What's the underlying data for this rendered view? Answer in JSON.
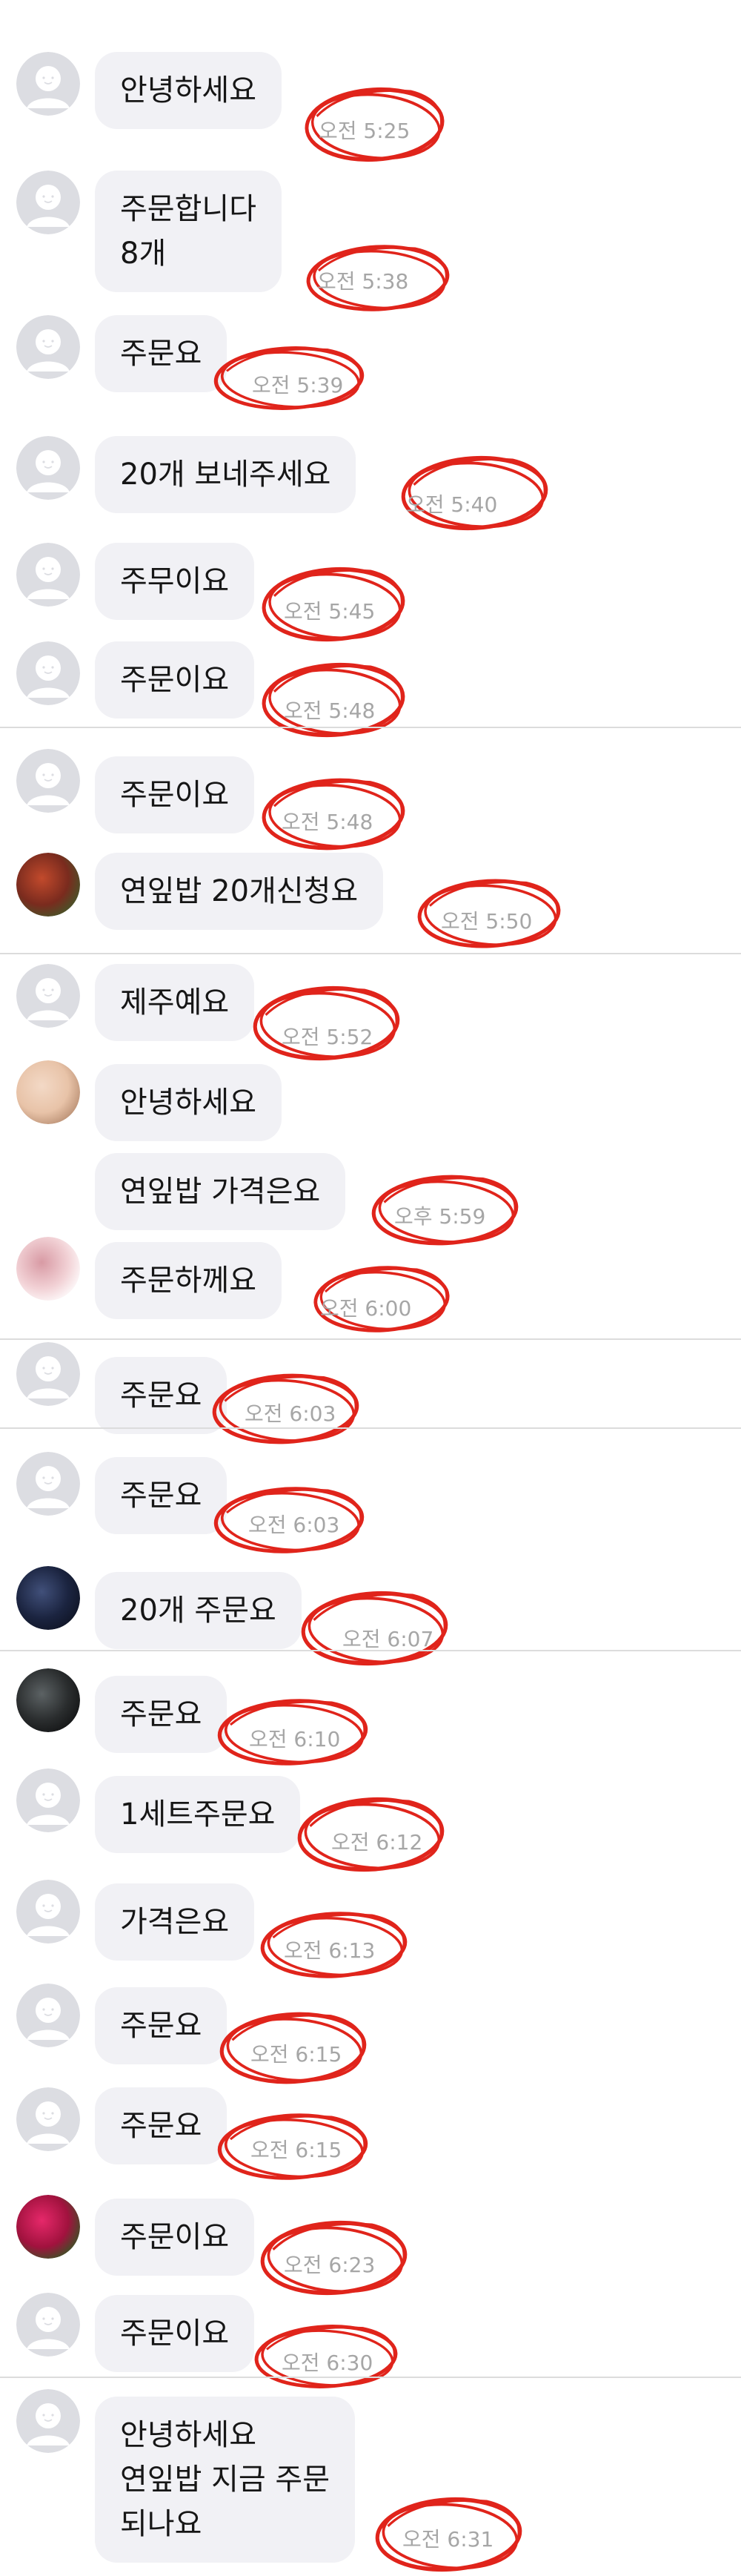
{
  "colors": {
    "bubble": "#f1f1f5",
    "text": "#161616",
    "timestamp": "#a6a6a6",
    "annotation_circle": "#e0241b",
    "default_avatar": "#dcdde2"
  },
  "messages": [
    {
      "lines": [
        "안녕하세요"
      ],
      "time": "오전 5:25",
      "avatar": "default-avatar-icon"
    },
    {
      "lines": [
        "주문합니다",
        "8개"
      ],
      "time": "오전 5:38",
      "avatar": "default-avatar-icon"
    },
    {
      "lines": [
        "주문요"
      ],
      "time": "오전 5:39",
      "avatar": "default-avatar-icon"
    },
    {
      "lines": [
        "20개 보네주세요"
      ],
      "time": "오전 5:40",
      "avatar": "default-avatar-icon"
    },
    {
      "lines": [
        "주무이요"
      ],
      "time": "오전 5:45",
      "avatar": "default-avatar-icon"
    },
    {
      "lines": [
        "주문이요"
      ],
      "time": "오전 5:48",
      "avatar": "default-avatar-icon"
    },
    {
      "lines": [
        "주문이요"
      ],
      "time": "오전 5:48",
      "avatar": "default-avatar-icon"
    },
    {
      "lines": [
        "연잎밥 20개신청요"
      ],
      "time": "오전 5:50",
      "avatar": "flower-photo-avatar"
    },
    {
      "lines": [
        "제주예요"
      ],
      "time": "오전 5:52",
      "avatar": "default-avatar-icon"
    },
    {
      "lines": [
        "안녕하세요"
      ],
      "time": "",
      "avatar": "baby-photo-avatar"
    },
    {
      "lines": [
        "연잎밥 가격은요"
      ],
      "time": "오후 5:59",
      "avatar": ""
    },
    {
      "lines": [
        "주문하께요"
      ],
      "time": "오전 6:00",
      "avatar": "character-photo-avatar"
    },
    {
      "lines": [
        "주문요"
      ],
      "time": "오전 6:03",
      "avatar": "default-avatar-icon"
    },
    {
      "lines": [
        "주문요"
      ],
      "time": "오전 6:03",
      "avatar": "default-avatar-icon"
    },
    {
      "lines": [
        "20개 주문요"
      ],
      "time": "오전 6:07",
      "avatar": "night-street-photo-avatar"
    },
    {
      "lines": [
        "주문요"
      ],
      "time": "오전 6:10",
      "avatar": "dark-photo-avatar"
    },
    {
      "lines": [
        "1세트주문요"
      ],
      "time": "오전 6:12",
      "avatar": "default-avatar-icon"
    },
    {
      "lines": [
        "가격은요"
      ],
      "time": "오전 6:13",
      "avatar": "default-avatar-icon"
    },
    {
      "lines": [
        "주문요"
      ],
      "time": "오전 6:15",
      "avatar": "default-avatar-icon"
    },
    {
      "lines": [
        "주문요"
      ],
      "time": "오전 6:15",
      "avatar": "default-avatar-icon"
    },
    {
      "lines": [
        "주문이요"
      ],
      "time": "오전 6:23",
      "avatar": "rose-photo-avatar"
    },
    {
      "lines": [
        "주문이요"
      ],
      "time": "오전 6:30",
      "avatar": "default-avatar-icon"
    },
    {
      "lines": [
        "안녕하세요",
        "연잎밥 지금 주문",
        "되나요"
      ],
      "time": "오전 6:31",
      "avatar": "default-avatar-icon"
    }
  ]
}
